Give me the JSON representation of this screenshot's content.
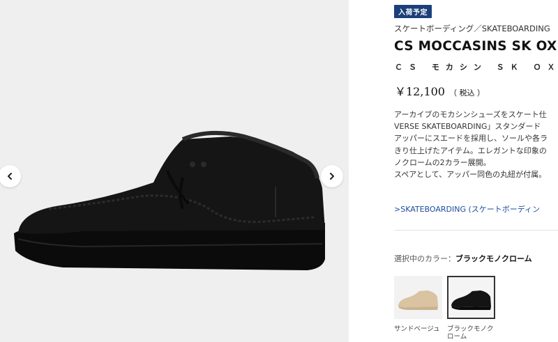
{
  "badge": "入荷予定",
  "category": "スケートボーディング／SKATEBOARDING",
  "title": "CS MOCCASINS SK OX",
  "subtitle": "ＣＳ モカシン ＳＫ ＯＸ",
  "price": {
    "amount": "￥12,100",
    "tax": "（ 税込 ）"
  },
  "description": [
    "アーカイブのモカシンシューズをスケート仕",
    "VERSE SKATEBOARDING」スタンダード",
    "アッパーにスエードを採用し、ソールや各ラ",
    "きり仕上げたアイテム。エレガントな印象の",
    "ノクロームの2カラー展開。",
    "スペアとして、アッパー同色の丸紐が付属。"
  ],
  "category_link": ">SKATEBOARDING (スケートボーディン",
  "color": {
    "label": "選択中のカラー：",
    "value": "ブラックモノクローム"
  },
  "swatches": [
    {
      "label": "サンドベージュ",
      "color": "#d9c3a0"
    },
    {
      "label": "ブラックモノクローム",
      "color": "#141414"
    }
  ],
  "gallery": {
    "background": "#efefef",
    "shoe_color": "#121212"
  }
}
